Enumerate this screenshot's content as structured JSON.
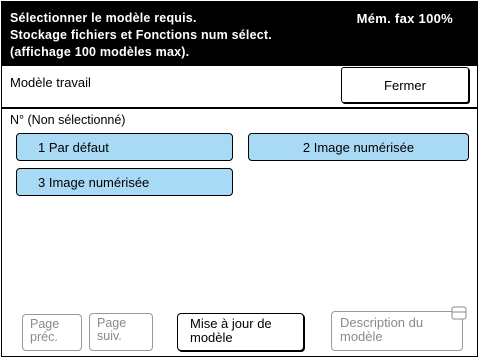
{
  "header": {
    "line1": "Sélectionner le modèle requis.",
    "line2": "Stockage fichiers et Fonctions num sélect.",
    "line3": "(affichage 100 modèles max).",
    "memory": "Mém. fax 100%"
  },
  "titlebar": {
    "label": "Modèle travail",
    "close_label": "Fermer"
  },
  "selection_status": "N° (Non sélectionné)",
  "templates": [
    {
      "label": "1 Par défaut"
    },
    {
      "label": "2 Image numérisée"
    },
    {
      "label": "3 Image numérisée"
    }
  ],
  "footer": {
    "prev_line1": "Page",
    "prev_line2": "préc.",
    "next_line1": "Page",
    "next_line2": "suiv.",
    "update_line1": "Mise à jour de",
    "update_line2": "modèle",
    "desc_line1": "Description du",
    "desc_line2": "modèle",
    "desc_icon": "description-icon"
  },
  "colors": {
    "template_fill": "#a9daf5",
    "header_bg": "#000000",
    "disabled_text": "#8a8a8a"
  }
}
